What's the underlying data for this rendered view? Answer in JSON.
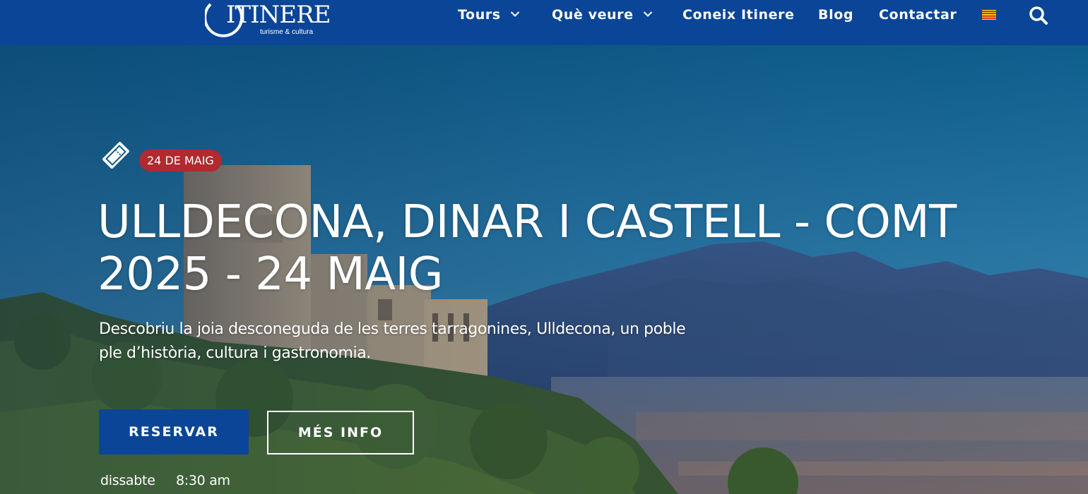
{
  "header": {
    "logo": {
      "wordmark": "ITINERE",
      "tagline": "turisme & cultura"
    },
    "nav": {
      "tours": "Tours",
      "que_veure": "Què veure",
      "coneix": "Coneix Itinere",
      "blog": "Blog",
      "contactar": "Contactar"
    },
    "language_flag": "catalan-flag",
    "search_icon": "search-icon"
  },
  "hero": {
    "date_badge": "24 DE MAIG",
    "title": "ULLDECONA, DINAR I CASTELL - COMT 2025 - 24 MAIG",
    "description": "Descobriu la joia desconeguda de les terres tarragonines, Ulldecona, un poble ple d’història, cultura i gastronomia.",
    "reserve_button": "RESERVAR",
    "info_button": "MÉS INFO",
    "day": "dissabte",
    "time": "8:30 am"
  },
  "colors": {
    "header_bg": "#0b4597",
    "badge_bg": "#b02a30",
    "primary_button": "#0b4597",
    "text": "#ffffff"
  }
}
